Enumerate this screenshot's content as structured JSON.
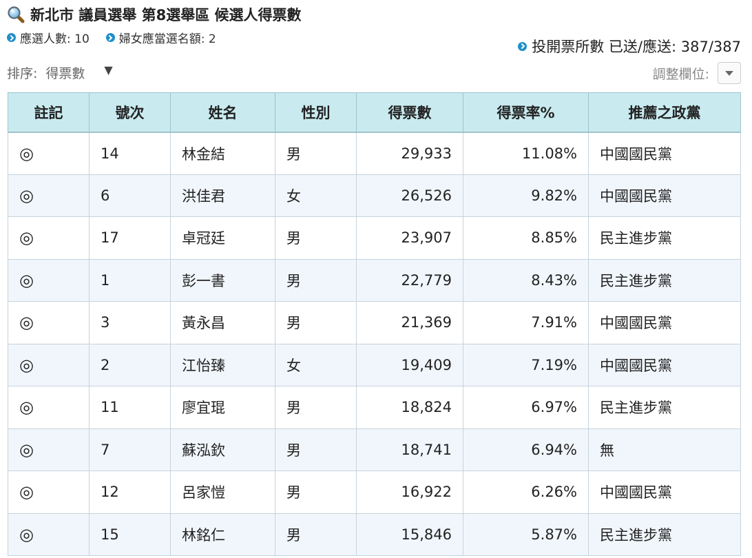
{
  "header": {
    "title": "新北市 議員選舉 第8選舉區 候選人得票數",
    "seats_label": "應選人數: 10",
    "women_quota_label": "婦女應當選名額: 2",
    "stations_label": "投開票所數 已送/應送: 387/387"
  },
  "controls": {
    "sort_label": "排序:",
    "sort_value": "得票數",
    "sort_arrow": "▼",
    "adjust_label": "調整欄位:"
  },
  "table": {
    "columns": [
      "註記",
      "號次",
      "姓名",
      "性別",
      "得票數",
      "得票率%",
      "推薦之政黨"
    ],
    "rows": [
      {
        "mark": "◎",
        "number": "14",
        "name": "林金結",
        "gender": "男",
        "votes": "29,933",
        "rate": "11.08%",
        "party": "中國國民黨"
      },
      {
        "mark": "◎",
        "number": "6",
        "name": "洪佳君",
        "gender": "女",
        "votes": "26,526",
        "rate": "9.82%",
        "party": "中國國民黨"
      },
      {
        "mark": "◎",
        "number": "17",
        "name": "卓冠廷",
        "gender": "男",
        "votes": "23,907",
        "rate": "8.85%",
        "party": "民主進步黨"
      },
      {
        "mark": "◎",
        "number": "1",
        "name": "彭一書",
        "gender": "男",
        "votes": "22,779",
        "rate": "8.43%",
        "party": "民主進步黨"
      },
      {
        "mark": "◎",
        "number": "3",
        "name": "黃永昌",
        "gender": "男",
        "votes": "21,369",
        "rate": "7.91%",
        "party": "中國國民黨"
      },
      {
        "mark": "◎",
        "number": "2",
        "name": "江怡臻",
        "gender": "女",
        "votes": "19,409",
        "rate": "7.19%",
        "party": "中國國民黨"
      },
      {
        "mark": "◎",
        "number": "11",
        "name": "廖宜琨",
        "gender": "男",
        "votes": "18,824",
        "rate": "6.97%",
        "party": "民主進步黨"
      },
      {
        "mark": "◎",
        "number": "7",
        "name": "蘇泓欽",
        "gender": "男",
        "votes": "18,741",
        "rate": "6.94%",
        "party": "無"
      },
      {
        "mark": "◎",
        "number": "12",
        "name": "呂家愷",
        "gender": "男",
        "votes": "16,922",
        "rate": "6.26%",
        "party": "中國國民黨"
      },
      {
        "mark": "◎",
        "number": "15",
        "name": "林銘仁",
        "gender": "男",
        "votes": "15,846",
        "rate": "5.87%",
        "party": "民主進步黨"
      }
    ]
  },
  "colors": {
    "header_bg": "#c9ebf0",
    "alt_row_bg": "#f1f6fc",
    "bullet": "#1f8fc9"
  },
  "icons": {
    "title": "magnifier-icon",
    "bullet": "chevron-circle-icon",
    "dropdown": "caret-down-icon"
  }
}
